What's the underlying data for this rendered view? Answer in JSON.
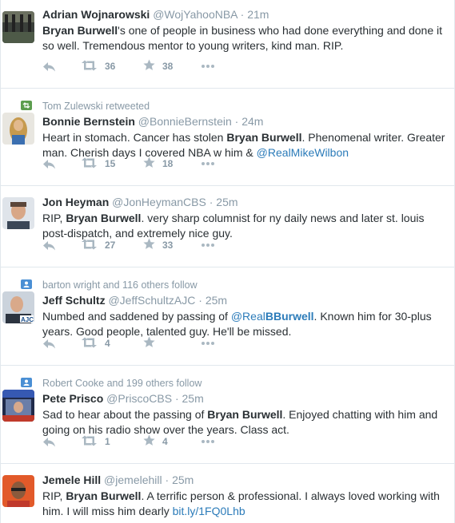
{
  "tweets": [
    {
      "context": "",
      "name": "Adrian Wojnarowski",
      "handle": "@WojYahooNBA",
      "dot": "·",
      "time": "21m",
      "text_parts": [
        {
          "t": "Bryan Burwell",
          "b": true
        },
        {
          "t": "'s one of people in business who had done everything and done it so well. Tremendous mentor to young writers, kind man. RIP.",
          "b": false
        }
      ],
      "retweets": "36",
      "favorites": "38"
    },
    {
      "context": "Tom Zulewski retweeted",
      "name": "Bonnie Bernstein",
      "handle": "@BonnieBernstein",
      "dot": "·",
      "time": "24m",
      "text_parts": [
        {
          "t": "Heart in stomach. Cancer has stolen ",
          "b": false
        },
        {
          "t": "Bryan Burwell",
          "b": true
        },
        {
          "t": ". Phenomenal writer. Greater man. Cherish days I covered NBA w him & ",
          "b": false
        },
        {
          "t": "@RealMikeWilbon",
          "l": true
        }
      ],
      "retweets": "15",
      "favorites": "18"
    },
    {
      "context": "",
      "name": "Jon Heyman",
      "handle": "@JonHeymanCBS",
      "dot": "·",
      "time": "25m",
      "text_parts": [
        {
          "t": "RIP, ",
          "b": false
        },
        {
          "t": "Bryan Burwell",
          "b": true
        },
        {
          "t": ". very sharp columnist for ny daily news and later st. louis post-dispatch, and extremely nice guy.",
          "b": false
        }
      ],
      "retweets": "27",
      "favorites": "33"
    },
    {
      "context": "barton wright and 116 others follow",
      "name": "Jeff Schultz",
      "handle": "@JeffSchultzAJC",
      "dot": "·",
      "time": "25m",
      "text_parts": [
        {
          "t": "Numbed and saddened by passing of ",
          "b": false
        },
        {
          "t": "@Real",
          "l": true
        },
        {
          "t": "BBurwell",
          "l": true,
          "b": true
        },
        {
          "t": ". Known him for 30-plus years. Good people, talented guy. He'll be missed.",
          "b": false
        }
      ],
      "retweets": "4",
      "favorites": ""
    },
    {
      "context": "Robert Cooke and 199 others follow",
      "name": "Pete Prisco",
      "handle": "@PriscoCBS",
      "dot": "·",
      "time": "25m",
      "text_parts": [
        {
          "t": "Sad to hear about the passing of ",
          "b": false
        },
        {
          "t": "Bryan Burwell",
          "b": true
        },
        {
          "t": ". Enjoyed chatting with him and going on his radio show over the years. Class act.",
          "b": false
        }
      ],
      "retweets": "1",
      "favorites": "4"
    },
    {
      "context": "",
      "name": "Jemele Hill",
      "handle": "@jemelehill",
      "dot": "·",
      "time": "25m",
      "text_parts": [
        {
          "t": "RIP, ",
          "b": false
        },
        {
          "t": "Bryan Burwell",
          "b": true
        },
        {
          "t": ". A terrific person & professional. I always loved working with him. I will miss him dearly ",
          "b": false
        },
        {
          "t": "bit.ly/1FQ0Lhb",
          "l": true
        }
      ],
      "retweets": "",
      "favorites": ""
    }
  ],
  "colors": {
    "accent": "#2b7bb9",
    "muted": "#8899a6",
    "icon": "#aab8c2",
    "retweet_badge": "#5c9d4e",
    "follow_badge": "#4a8fd4"
  }
}
